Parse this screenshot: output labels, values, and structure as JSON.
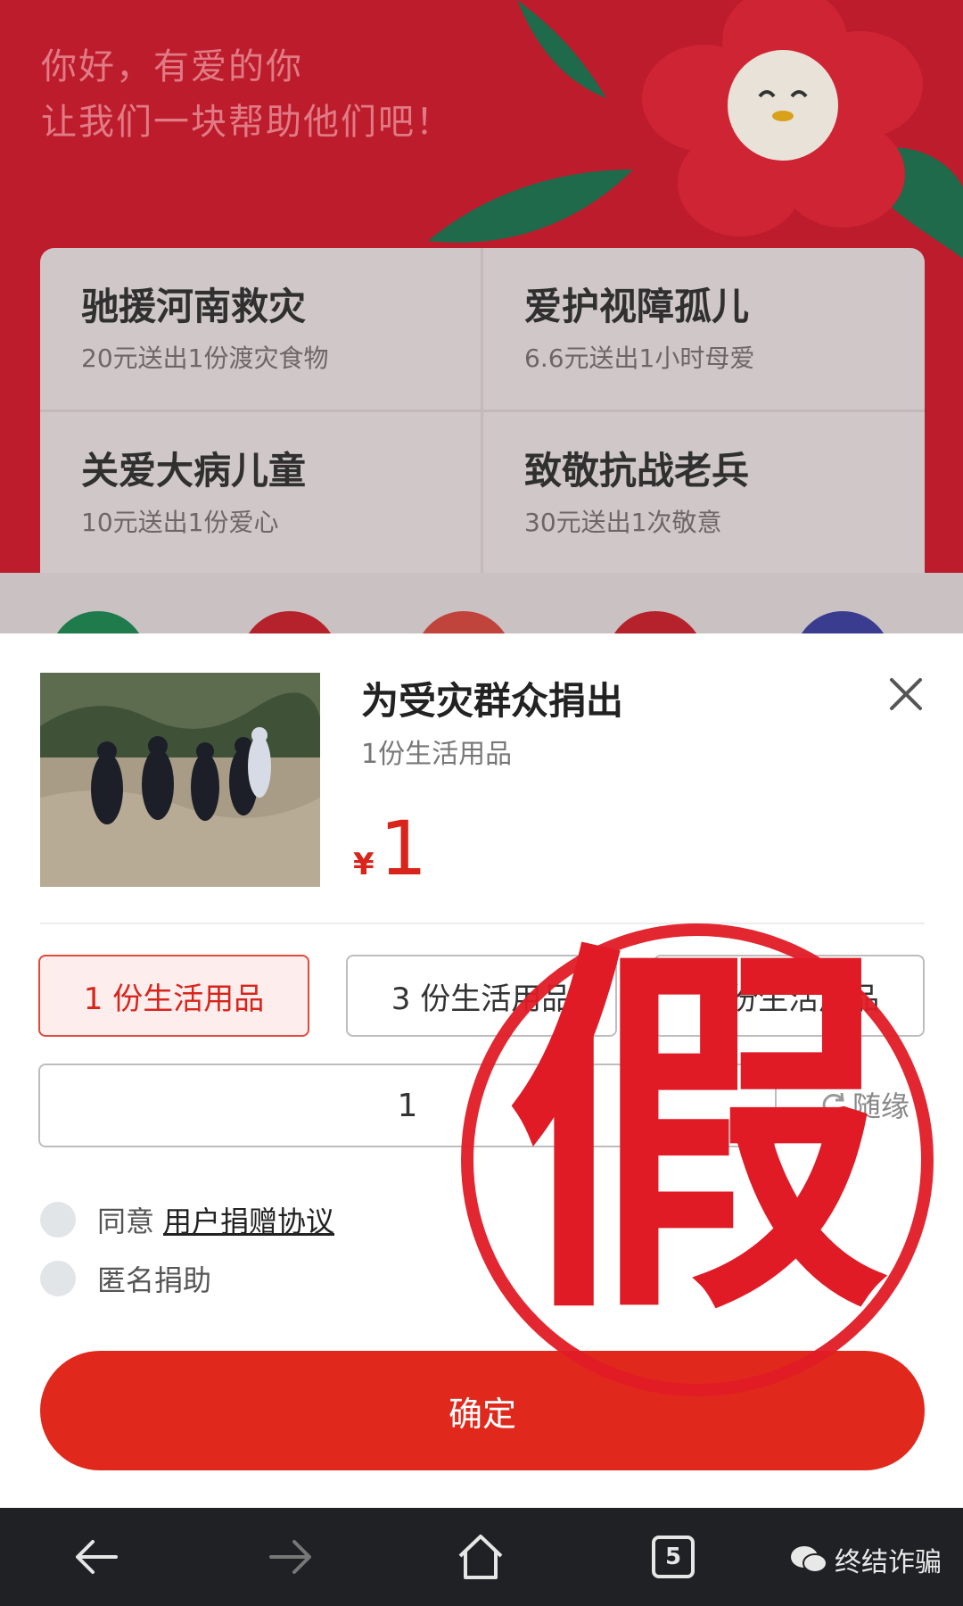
{
  "background_page": {
    "greeting_line1": "你好，有爱的你",
    "greeting_line2": "让我们一块帮助他们吧！",
    "projects": [
      {
        "title": "驰援河南救灾",
        "subtitle": "20元送出1份渡灾食物"
      },
      {
        "title": "爱护视障孤儿",
        "subtitle": "6.6元送出1小时母爱"
      },
      {
        "title": "关爱大病儿童",
        "subtitle": "10元送出1份爱心"
      },
      {
        "title": "致敬抗战老兵",
        "subtitle": "30元送出1次敬意"
      }
    ]
  },
  "sheet": {
    "title": "为受灾群众捐出",
    "subtitle": "1份生活用品",
    "currency": "¥",
    "price": "1",
    "options": [
      "1 份生活用品",
      "3 份生活用品",
      "5 份生活用品"
    ],
    "selected_option": 0,
    "amount_value": "1",
    "random_label": "随缘",
    "agree_label": "同意",
    "agreement_link": "用户捐赠协议",
    "anonymous_label": "匿名捐助",
    "confirm_label": "确定"
  },
  "stamp": {
    "text": "假"
  },
  "navbar": {
    "tab_count": "5",
    "watermark": "终结诈骗"
  },
  "colors": {
    "brand_red": "#e0291c",
    "price_red": "#d8241b",
    "bg_red": "#bd1c2c",
    "stamp_red": "#e01b26"
  }
}
